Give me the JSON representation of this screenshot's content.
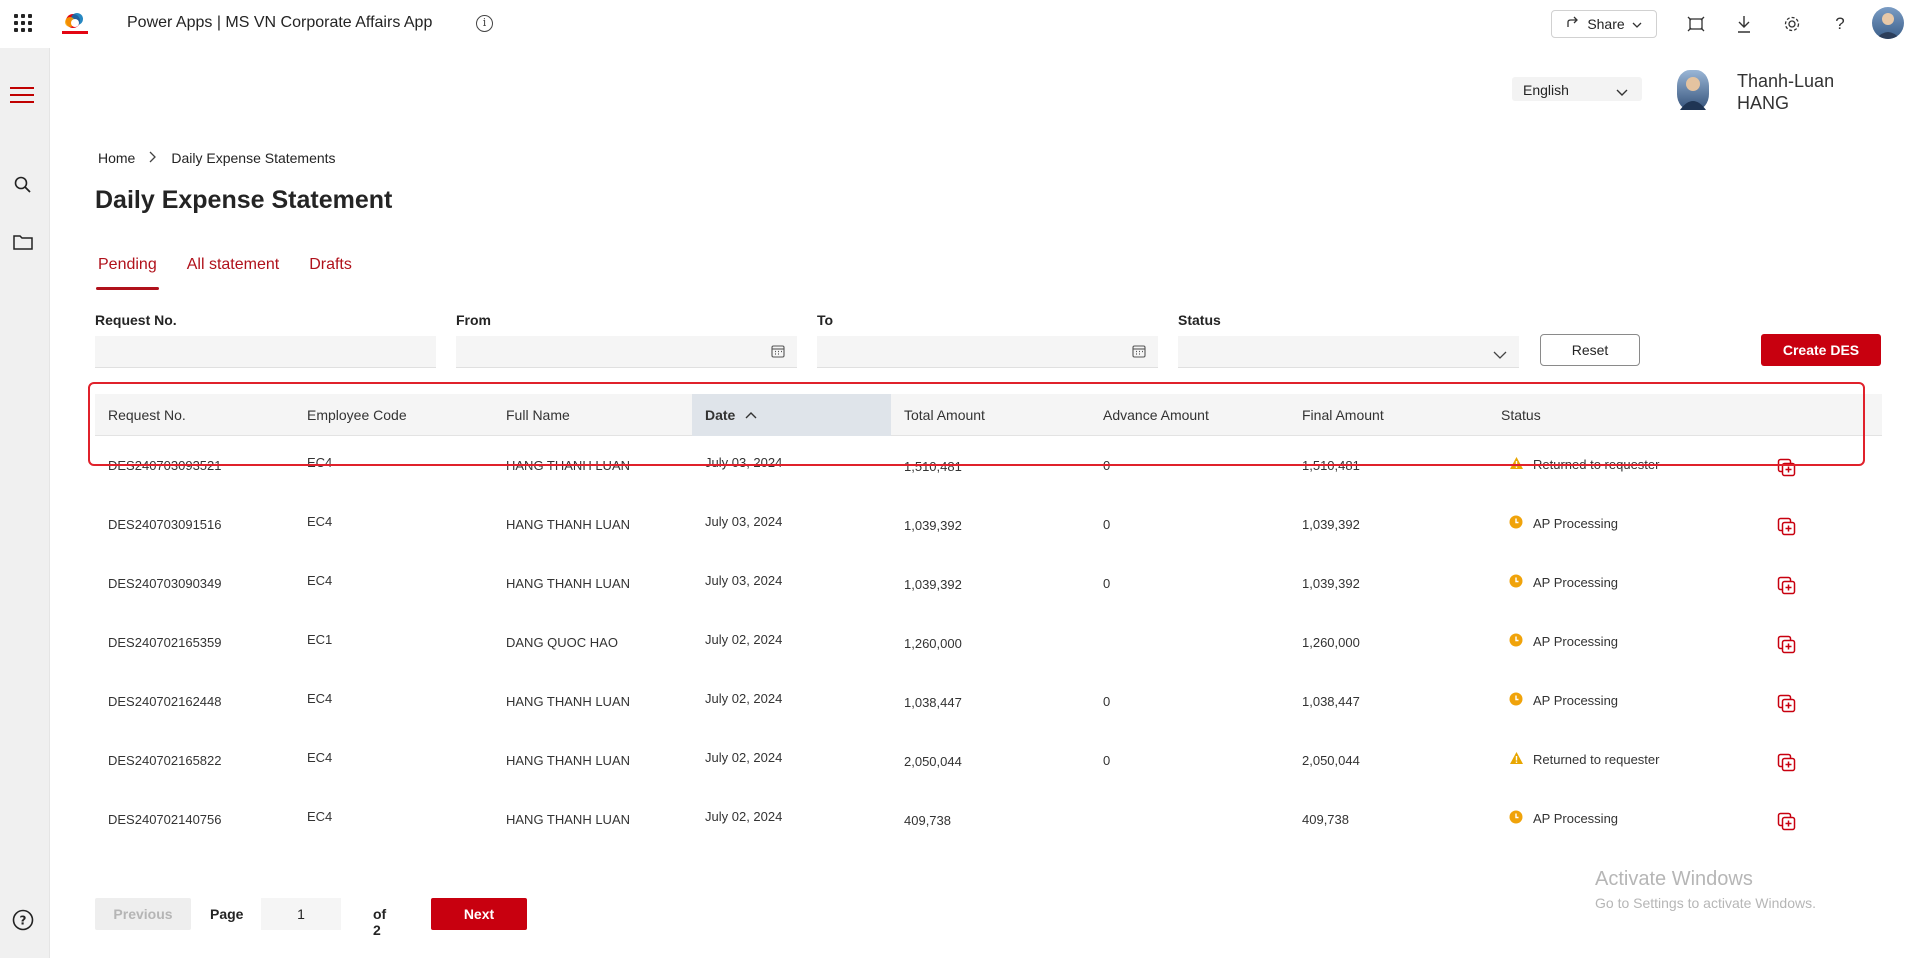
{
  "topbar": {
    "app_title": "Power Apps  |  MS VN Corporate Affairs App",
    "share_label": "Share",
    "logo_text": "TotalEnergies"
  },
  "header": {
    "language": "English",
    "user_name_line1": "Thanh-Luan",
    "user_name_line2": "HANG"
  },
  "breadcrumb": {
    "home": "Home",
    "current": "Daily Expense Statements"
  },
  "page_title": "Daily Expense Statement",
  "tabs": [
    {
      "label": "Pending",
      "active": true
    },
    {
      "label": "All statement",
      "active": false
    },
    {
      "label": "Drafts",
      "active": false
    }
  ],
  "filters": {
    "request_no_label": "Request No.",
    "from_label": "From",
    "to_label": "To",
    "status_label": "Status",
    "request_no_value": "",
    "from_value": "",
    "to_value": "",
    "status_value": ""
  },
  "buttons": {
    "reset": "Reset",
    "create": "Create DES"
  },
  "table": {
    "columns": [
      "Request No.",
      "Employee Code",
      "Full Name",
      "Date",
      "Total Amount",
      "Advance Amount",
      "Final Amount",
      "Status"
    ],
    "sorted_column": "Date",
    "rows": [
      {
        "request_no": "DES240703093521",
        "employee_code": "EC4",
        "full_name": "HANG THANH LUAN",
        "date": "July 03, 2024",
        "total": "1,510,481",
        "advance": "0",
        "final": "1,510,481",
        "status": "Returned to requester",
        "status_type": "warning"
      },
      {
        "request_no": "DES240703091516",
        "employee_code": "EC4",
        "full_name": "HANG THANH LUAN",
        "date": "July 03, 2024",
        "total": "1,039,392",
        "advance": "0",
        "final": "1,039,392",
        "status": "AP Processing",
        "status_type": "clock"
      },
      {
        "request_no": "DES240703090349",
        "employee_code": "EC4",
        "full_name": "HANG THANH LUAN",
        "date": "July 03, 2024",
        "total": "1,039,392",
        "advance": "0",
        "final": "1,039,392",
        "status": "AP Processing",
        "status_type": "clock"
      },
      {
        "request_no": "DES240702165359",
        "employee_code": "EC1",
        "full_name": "DANG QUOC HAO",
        "date": "July 02, 2024",
        "total": "1,260,000",
        "advance": "",
        "final": "1,260,000",
        "status": "AP Processing",
        "status_type": "clock"
      },
      {
        "request_no": "DES240702162448",
        "employee_code": "EC4",
        "full_name": "HANG THANH LUAN",
        "date": "July 02, 2024",
        "total": "1,038,447",
        "advance": "0",
        "final": "1,038,447",
        "status": "AP Processing",
        "status_type": "clock"
      },
      {
        "request_no": "DES240702165822",
        "employee_code": "EC4",
        "full_name": "HANG THANH LUAN",
        "date": "July 02, 2024",
        "total": "2,050,044",
        "advance": "0",
        "final": "2,050,044",
        "status": "Returned to requester",
        "status_type": "warning"
      },
      {
        "request_no": "DES240702140756",
        "employee_code": "EC4",
        "full_name": "HANG THANH LUAN",
        "date": "July 02, 2024",
        "total": "409,738",
        "advance": "",
        "final": "409,738",
        "status": "AP Processing",
        "status_type": "clock"
      }
    ]
  },
  "pager": {
    "previous": "Previous",
    "page_label": "Page",
    "current_page": "1",
    "of_label": "of 2",
    "next": "Next"
  },
  "watermark": {
    "line1": "Activate Windows",
    "line2": "Go to Settings to activate Windows."
  },
  "colors": {
    "brand_red": "#c8000f",
    "tab_red": "#b0111b",
    "warning": "#e8a600",
    "clock": "#f0a30a"
  }
}
